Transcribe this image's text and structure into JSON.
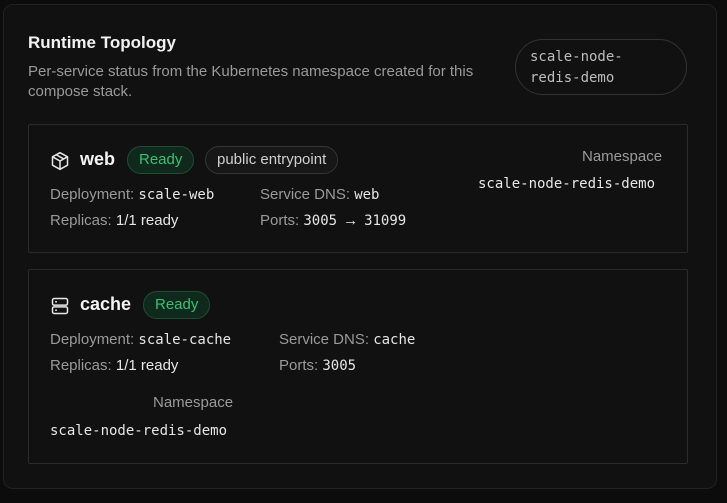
{
  "header": {
    "title": "Runtime Topology",
    "subtitle": "Per-service status from the Kubernetes namespace created for this compose stack.",
    "namespace_chip_line1": "scale-node-",
    "namespace_chip_line2": "redis-demo"
  },
  "services": [
    {
      "name": "web",
      "icon": "package-icon",
      "status": "Ready",
      "tag": "public entrypoint",
      "deployment_label": "Deployment:",
      "deployment": "scale-web",
      "replicas_label": "Replicas:",
      "replicas": "1/1 ready",
      "dns_label": "Service DNS:",
      "dns": "web",
      "ports_label": "Ports:",
      "port": "3005",
      "arrow": "→",
      "node_port": "31099",
      "namespace_label": "Namespace",
      "namespace": "scale-node-redis-demo"
    },
    {
      "name": "cache",
      "icon": "server-icon",
      "status": "Ready",
      "deployment_label": "Deployment:",
      "deployment": "scale-cache",
      "replicas_label": "Replicas:",
      "replicas": "1/1 ready",
      "dns_label": "Service DNS:",
      "dns": "cache",
      "ports_label": "Ports:",
      "port": "3005",
      "namespace_label": "Namespace",
      "namespace": "scale-node-redis-demo"
    }
  ],
  "colors": {
    "ready_text": "#3fbf73",
    "ready_bg": "#0f2a1d",
    "background": "#111111"
  }
}
